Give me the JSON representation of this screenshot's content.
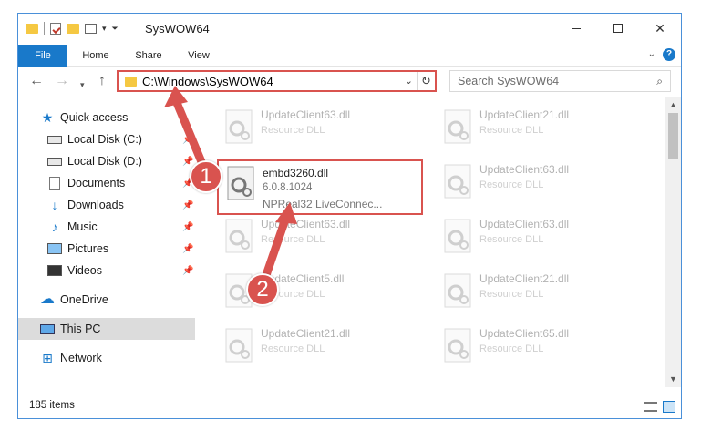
{
  "window": {
    "title": "SysWOW64"
  },
  "ribbon": {
    "tabs": [
      "File",
      "Home",
      "Share",
      "View"
    ],
    "help": "?"
  },
  "nav": {
    "address": "C:\\Windows\\SysWOW64",
    "search_placeholder": "Search SysWOW64"
  },
  "sidebar": {
    "items": [
      {
        "label": "Quick access",
        "icon": "star-icon"
      },
      {
        "label": "Local Disk (C:)",
        "icon": "drive-icon"
      },
      {
        "label": "Local Disk (D:)",
        "icon": "drive-icon"
      },
      {
        "label": "Documents",
        "icon": "documents-icon"
      },
      {
        "label": "Downloads",
        "icon": "download-icon"
      },
      {
        "label": "Music",
        "icon": "music-icon"
      },
      {
        "label": "Pictures",
        "icon": "pictures-icon"
      },
      {
        "label": "Videos",
        "icon": "videos-icon"
      },
      {
        "label": "OneDrive",
        "icon": "cloud-icon"
      },
      {
        "label": "This PC",
        "icon": "computer-icon"
      },
      {
        "label": "Network",
        "icon": "network-icon"
      }
    ]
  },
  "files": {
    "highlighted": {
      "name": "embd3260.dll",
      "version": "6.0.8.1024",
      "description": "NPReal32 LiveConnec..."
    },
    "faded": [
      {
        "name": "UpdateClient63.dll",
        "type": "Resource DLL"
      },
      {
        "name": "UpdateClient21.dll",
        "type": "Resource DLL"
      },
      {
        "name": "UpdateClient63.dll",
        "type": "Resource DLL"
      },
      {
        "name": "UpdateClient63.dll",
        "type": "Resource DLL"
      },
      {
        "name": "UpdateClient63.dll",
        "type": "Resource DLL"
      },
      {
        "name": "UpdateClient5.dll",
        "type": "Resource DLL"
      },
      {
        "name": "UpdateClient21.dll",
        "type": "Resource DLL"
      },
      {
        "name": "UpdateClient21.dll",
        "type": "Resource DLL"
      },
      {
        "name": "UpdateClient65.dll",
        "type": "Resource DLL"
      }
    ]
  },
  "status": {
    "count": "185 items"
  },
  "annotations": {
    "step1": "1",
    "step2": "2"
  },
  "colors": {
    "accent": "#1979ca",
    "highlight": "#d9534f"
  }
}
